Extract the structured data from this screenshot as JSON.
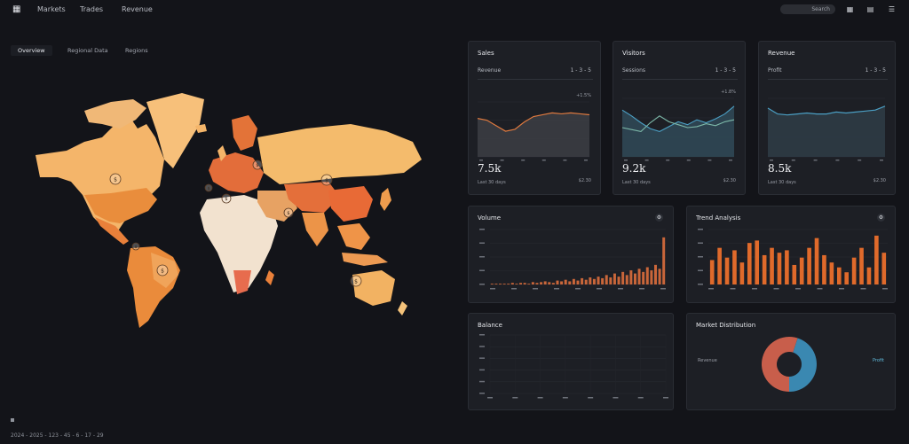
{
  "app": {
    "logo_icon": "dashboard-logo-icon",
    "nav": [
      "Markets",
      "Trades",
      "Revenue"
    ],
    "search_label": "Search"
  },
  "tabs": [
    "Overview",
    "Regional Data",
    "Regions"
  ],
  "map": {
    "markers": [
      "$",
      "$",
      "$",
      "$",
      "$",
      "$",
      "$",
      "$",
      "$"
    ]
  },
  "kpi_cards": [
    {
      "title": "Sales",
      "subtitle": "Revenue",
      "range": "1 - 3 - 5",
      "delta": "+1.5%",
      "value": "7.5k",
      "footer_left": "Last 30 days",
      "footer_right": "$2.30"
    },
    {
      "title": "Visitors",
      "subtitle": "Sessions",
      "range": "1 - 3 - 5",
      "delta": "+1.8%",
      "value": "9.2k",
      "footer_left": "Last 30 days",
      "footer_right": "$2.30"
    },
    {
      "title": "Revenue",
      "subtitle": "Profit",
      "range": "1 - 3 - 5",
      "delta": "",
      "value": "8.5k",
      "footer_left": "Last 30 days",
      "footer_right": "$2.30"
    }
  ],
  "panels": {
    "mid_left_title": "Volume",
    "mid_right_title": "Trend Analysis",
    "bottom_left_title": "Balance",
    "bottom_right_title": "Market Distribution",
    "donut_left_label": "Revenue",
    "donut_right_label": "Profit"
  },
  "footer": {
    "text": "2024 - 2025 - 123 - 45 - 6 - 17 - 29"
  },
  "colors": {
    "accent": "#e07a3f",
    "blue": "#4b9fc4",
    "panel": "#1d1f25",
    "map_light": "#f4c27a",
    "map_dark": "#e57b30"
  },
  "chart_data": [
    {
      "type": "area",
      "x": [
        0,
        1,
        2,
        3,
        4,
        5,
        6,
        7,
        8,
        9,
        10,
        11,
        12
      ],
      "values": [
        42,
        40,
        34,
        28,
        30,
        38,
        44,
        46,
        48,
        47,
        48,
        47,
        46
      ],
      "ylim": [
        0,
        60
      ],
      "xlabel": "",
      "ylabel": ""
    },
    {
      "type": "line",
      "x": [
        0,
        1,
        2,
        3,
        4,
        5,
        6,
        7,
        8,
        9,
        10,
        11,
        12
      ],
      "series": [
        {
          "values": [
            48,
            42,
            35,
            29,
            26,
            31,
            36,
            33,
            38,
            35,
            39,
            44,
            52
          ]
        },
        {
          "values": [
            30,
            28,
            26,
            35,
            42,
            36,
            33,
            30,
            31,
            34,
            32,
            36,
            38
          ]
        }
      ],
      "ylim": [
        0,
        60
      ]
    },
    {
      "type": "area",
      "x": [
        0,
        1,
        2,
        3,
        4,
        5,
        6,
        7,
        8,
        9,
        10,
        11,
        12
      ],
      "values": [
        50,
        44,
        43,
        44,
        45,
        44,
        44,
        46,
        45,
        46,
        47,
        48,
        52
      ],
      "ylim": [
        0,
        60
      ]
    },
    {
      "type": "bar",
      "values": [
        1,
        1,
        1,
        1,
        1,
        2,
        1,
        2,
        2,
        1,
        3,
        2,
        3,
        4,
        3,
        2,
        5,
        4,
        6,
        4,
        7,
        5,
        8,
        6,
        9,
        7,
        10,
        8,
        12,
        9,
        14,
        10,
        16,
        12,
        18,
        14,
        20,
        16,
        22,
        18,
        25,
        20,
        60
      ],
      "ylim": [
        0,
        70
      ]
    },
    {
      "type": "bar",
      "values": [
        20,
        30,
        22,
        28,
        18,
        34,
        36,
        24,
        30,
        26,
        28,
        16,
        22,
        30,
        38,
        24,
        18,
        14,
        10,
        22,
        30,
        14,
        40,
        26
      ],
      "ylim": [
        0,
        45
      ]
    },
    {
      "type": "pie",
      "values": [
        55,
        45
      ],
      "labels": [
        "Revenue",
        "Profit"
      ]
    }
  ]
}
